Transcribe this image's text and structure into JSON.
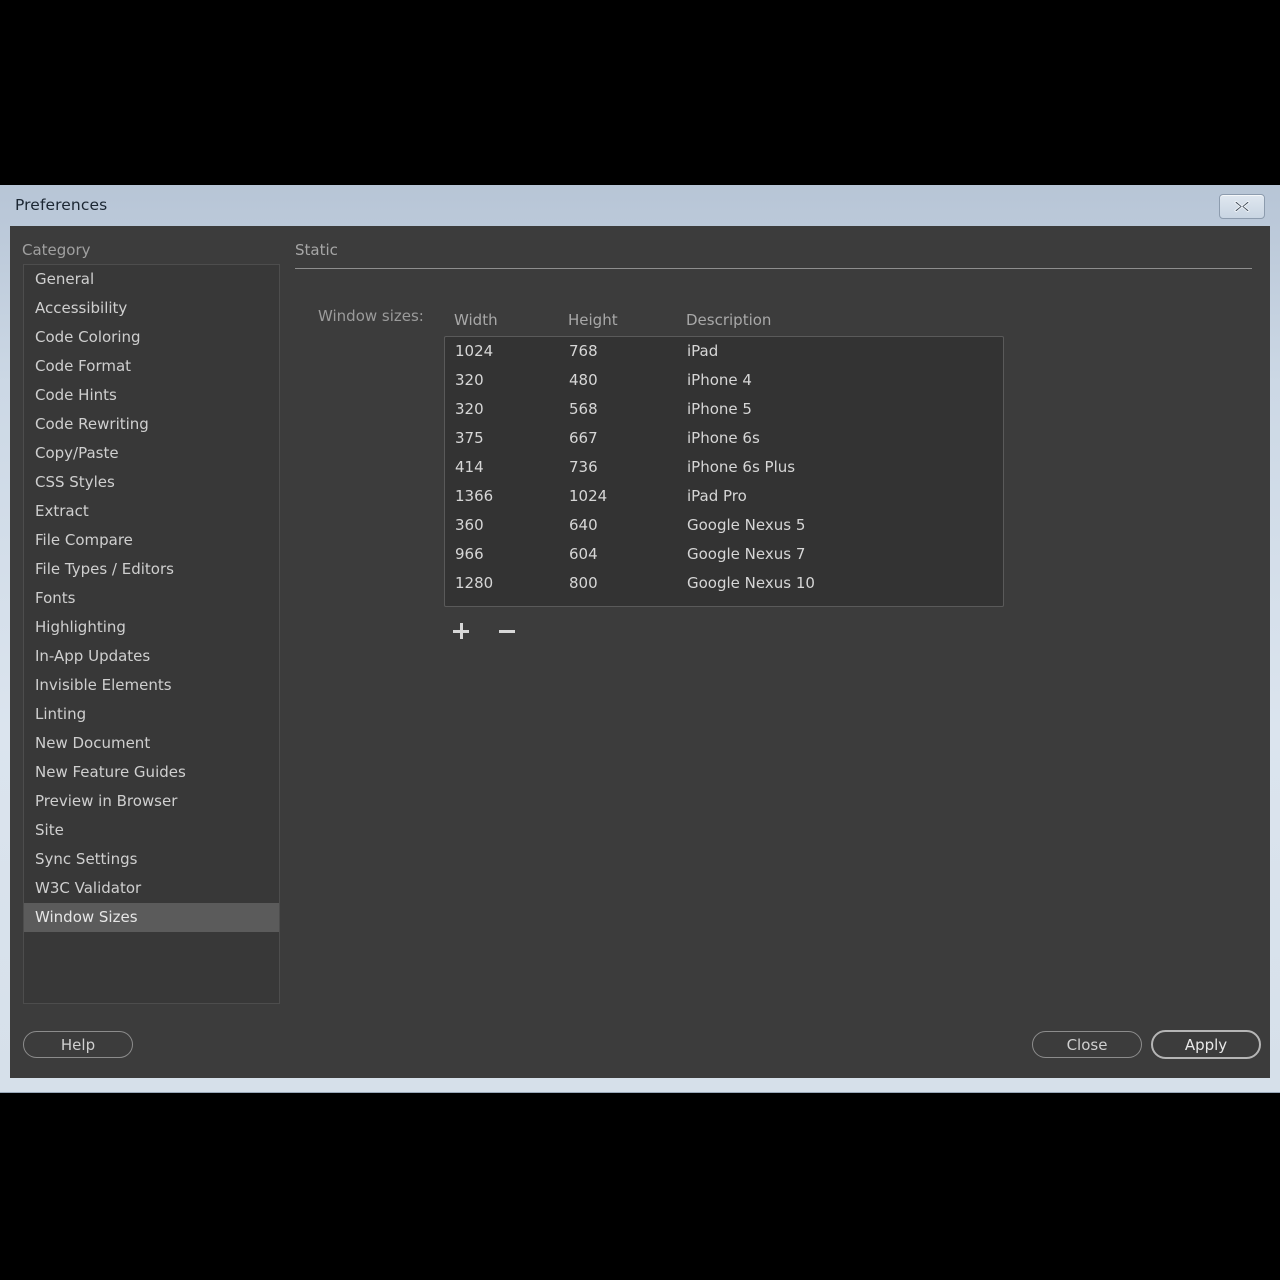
{
  "window": {
    "title": "Preferences",
    "close_icon": "close-x-icon"
  },
  "sidebar": {
    "label": "Category",
    "items": [
      {
        "label": "General",
        "selected": false
      },
      {
        "label": "Accessibility",
        "selected": false
      },
      {
        "label": "Code Coloring",
        "selected": false
      },
      {
        "label": "Code Format",
        "selected": false
      },
      {
        "label": "Code Hints",
        "selected": false
      },
      {
        "label": "Code Rewriting",
        "selected": false
      },
      {
        "label": "Copy/Paste",
        "selected": false
      },
      {
        "label": "CSS Styles",
        "selected": false
      },
      {
        "label": "Extract",
        "selected": false
      },
      {
        "label": "File Compare",
        "selected": false
      },
      {
        "label": "File Types / Editors",
        "selected": false
      },
      {
        "label": "Fonts",
        "selected": false
      },
      {
        "label": "Highlighting",
        "selected": false
      },
      {
        "label": "In-App Updates",
        "selected": false
      },
      {
        "label": "Invisible Elements",
        "selected": false
      },
      {
        "label": "Linting",
        "selected": false
      },
      {
        "label": "New Document",
        "selected": false
      },
      {
        "label": "New Feature Guides",
        "selected": false
      },
      {
        "label": "Preview in Browser",
        "selected": false
      },
      {
        "label": "Site",
        "selected": false
      },
      {
        "label": "Sync Settings",
        "selected": false
      },
      {
        "label": "W3C Validator",
        "selected": false
      },
      {
        "label": "Window Sizes",
        "selected": true
      }
    ]
  },
  "main": {
    "section_title": "Static",
    "field_label": "Window sizes:",
    "table": {
      "columns": [
        "Width",
        "Height",
        "Description"
      ],
      "rows": [
        [
          "1024",
          "768",
          "iPad"
        ],
        [
          "320",
          "480",
          "iPhone 4"
        ],
        [
          "320",
          "568",
          "iPhone 5"
        ],
        [
          "375",
          "667",
          "iPhone 6s"
        ],
        [
          "414",
          "736",
          "iPhone 6s Plus"
        ],
        [
          "1366",
          "1024",
          "iPad Pro"
        ],
        [
          "360",
          "640",
          "Google Nexus 5"
        ],
        [
          "966",
          "604",
          "Google Nexus 7"
        ],
        [
          "1280",
          "800",
          "Google Nexus 10"
        ]
      ]
    },
    "add_button": {
      "icon": "plus-icon",
      "label": "+"
    },
    "remove_button": {
      "icon": "minus-icon",
      "label": "−"
    }
  },
  "footer": {
    "help_label": "Help",
    "close_label": "Close",
    "apply_label": "Apply"
  },
  "colors": {
    "panel_background": "#3c3c3c",
    "list_background": "#383838",
    "table_background": "#333333",
    "selection": "#5b5b5b",
    "titlebar_top": "#b7c5d6",
    "titlebar_bottom": "#d6e0ea",
    "text_primary": "#d6d6d6",
    "text_muted": "#a0a0a0"
  }
}
